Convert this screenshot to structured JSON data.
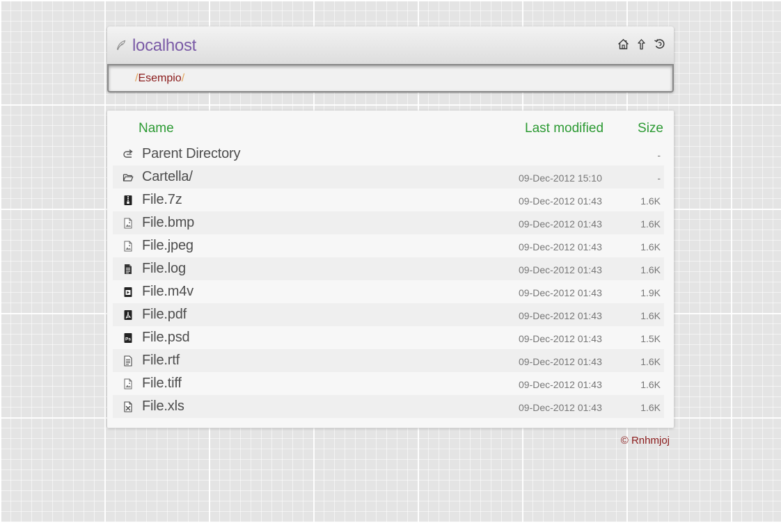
{
  "header": {
    "title": "localhost",
    "title_icon": "feather-icon",
    "nav_icons": [
      "home-icon",
      "up-arrow-icon",
      "refresh-icon"
    ]
  },
  "breadcrumb": {
    "separator": "/",
    "items": [
      "Esempio"
    ]
  },
  "table": {
    "headers": {
      "name": "Name",
      "last_modified": "Last modified",
      "size": "Size"
    },
    "rows": [
      {
        "icon": "parent-directory-icon",
        "name": "Parent Directory",
        "modified": "",
        "size": "-"
      },
      {
        "icon": "folder-icon",
        "name": "Cartella/",
        "modified": "09-Dec-2012 15:10",
        "size": "-"
      },
      {
        "icon": "archive-file-icon",
        "name": "File.7z",
        "modified": "09-Dec-2012 01:43",
        "size": "1.6K"
      },
      {
        "icon": "image-file-icon",
        "name": "File.bmp",
        "modified": "09-Dec-2012 01:43",
        "size": "1.6K"
      },
      {
        "icon": "image-file-icon",
        "name": "File.jpeg",
        "modified": "09-Dec-2012 01:43",
        "size": "1.6K"
      },
      {
        "icon": "text-file-icon",
        "name": "File.log",
        "modified": "09-Dec-2012 01:43",
        "size": "1.6K"
      },
      {
        "icon": "video-file-icon",
        "name": "File.m4v",
        "modified": "09-Dec-2012 01:43",
        "size": "1.9K"
      },
      {
        "icon": "pdf-file-icon",
        "name": "File.pdf",
        "modified": "09-Dec-2012 01:43",
        "size": "1.6K"
      },
      {
        "icon": "psd-file-icon",
        "name": "File.psd",
        "modified": "09-Dec-2012 01:43",
        "size": "1.5K"
      },
      {
        "icon": "document-file-icon",
        "name": "File.rtf",
        "modified": "09-Dec-2012 01:43",
        "size": "1.6K"
      },
      {
        "icon": "image-file-icon",
        "name": "File.tiff",
        "modified": "09-Dec-2012 01:43",
        "size": "1.6K"
      },
      {
        "icon": "spreadsheet-file-icon",
        "name": "File.xls",
        "modified": "09-Dec-2012 01:43",
        "size": "1.6K"
      }
    ]
  },
  "footer": {
    "credit": "© Rnhmjoj"
  },
  "colors": {
    "title": "#7a5aa6",
    "header_text": "#2c9a33",
    "breadcrumb": "#8a1a1a",
    "breadcrumb_separator": "#e2a35a",
    "row_alt": "#efefef"
  }
}
